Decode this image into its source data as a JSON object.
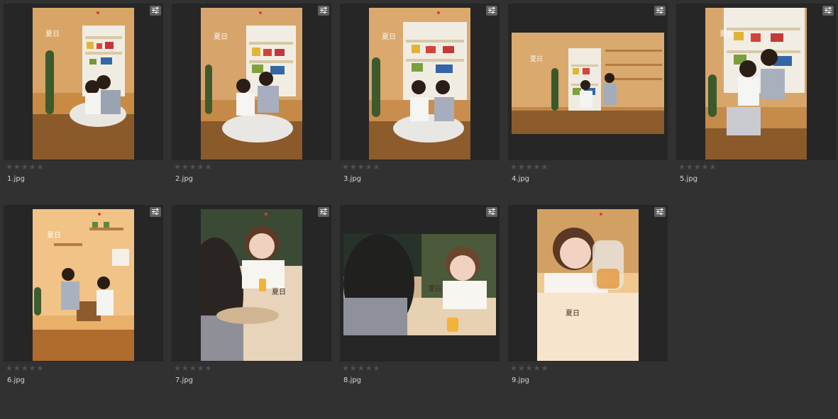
{
  "files": [
    {
      "name": "1.jpg",
      "rating": "★★★★★",
      "theme": "couple-floor-fridge",
      "orientation": "portrait"
    },
    {
      "name": "2.jpg",
      "rating": "★★★★★",
      "theme": "couple-floor-fridge",
      "orientation": "portrait"
    },
    {
      "name": "3.jpg",
      "rating": "★★★★★",
      "theme": "couple-floor-fridge",
      "orientation": "portrait"
    },
    {
      "name": "4.jpg",
      "rating": "★★★★★",
      "theme": "couple-room-wide",
      "orientation": "landscape"
    },
    {
      "name": "5.jpg",
      "rating": "★★★★★",
      "theme": "couple-closeup-fridge",
      "orientation": "portrait"
    },
    {
      "name": "6.jpg",
      "rating": "★★★★★",
      "theme": "couple-shelves",
      "orientation": "portrait"
    },
    {
      "name": "7.jpg",
      "rating": "★★★★★",
      "theme": "woman-smiling-cafe",
      "orientation": "portrait"
    },
    {
      "name": "8.jpg",
      "rating": "★★★★★",
      "theme": "cafe-couple",
      "orientation": "landscape"
    },
    {
      "name": "9.jpg",
      "rating": "★★★★★",
      "theme": "woman-jar",
      "orientation": "portrait"
    }
  ],
  "icons": {
    "settings": "sliders-icon"
  },
  "colors": {
    "background": "#313131",
    "frame": "#262626",
    "text": "#d6d6d6",
    "stars": "#515151",
    "accent_heart": "#e23b3b"
  }
}
